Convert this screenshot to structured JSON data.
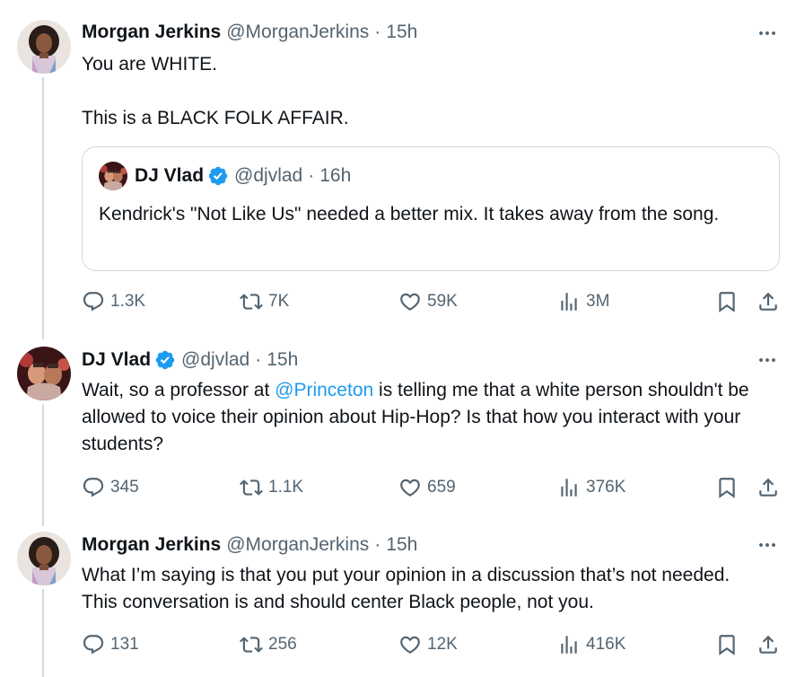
{
  "tweets": [
    {
      "name": "Morgan Jerkins",
      "handle": "@MorganJerkins",
      "sep": "·",
      "time": "15h",
      "lines": [
        "You are WHITE.",
        "This is a BLACK FOLK AFFAIR."
      ],
      "quote": {
        "name": "DJ Vlad",
        "handle": "@djvlad",
        "sep": "·",
        "time": "16h",
        "text": "Kendrick's \"Not Like Us\" needed a better mix.  It takes away from the song."
      },
      "stats": {
        "replies": "1.3K",
        "reposts": "7K",
        "likes": "59K",
        "views": "3M"
      }
    },
    {
      "name": "DJ Vlad",
      "handle": "@djvlad",
      "sep": "·",
      "time": "15h",
      "text_before": "Wait, so a professor at ",
      "mention": "@Princeton",
      "text_after": " is telling me that a white person shouldn't be allowed to voice their opinion about Hip-Hop?  Is that how you interact with your students?",
      "stats": {
        "replies": "345",
        "reposts": "1.1K",
        "likes": "659",
        "views": "376K"
      }
    },
    {
      "name": "Morgan Jerkins",
      "handle": "@MorganJerkins",
      "sep": "·",
      "time": "15h",
      "text": "What I’m saying is that you put your opinion in a discussion that’s not needed. This conversation is and should center Black people, not you.",
      "stats": {
        "replies": "131",
        "reposts": "256",
        "likes": "12K",
        "views": "416K"
      }
    }
  ],
  "icons": {
    "reply": "reply-icon",
    "repost": "repost-icon",
    "like": "heart-icon",
    "views": "views-icon",
    "bookmark": "bookmark-icon",
    "share": "share-icon",
    "more": "more-icon",
    "verified": "verified-badge-icon"
  },
  "colors": {
    "link": "#1d9bf0",
    "muted": "#536471",
    "text": "#0f1419",
    "border": "#cfd9de"
  }
}
